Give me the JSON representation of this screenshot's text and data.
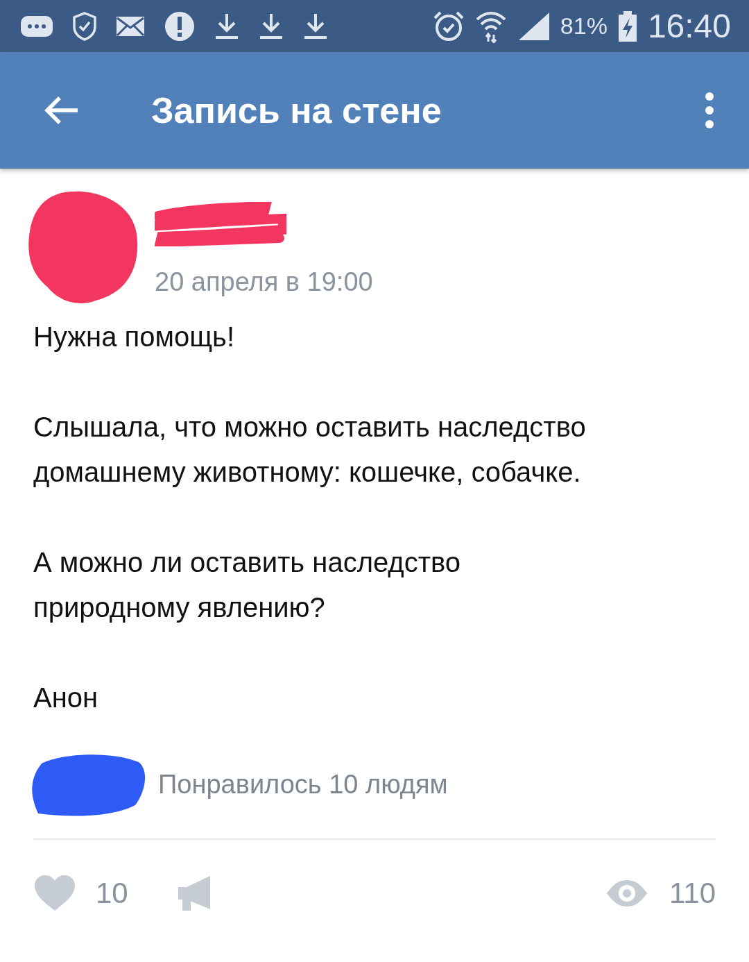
{
  "status_bar": {
    "battery": "81%",
    "time": "16:40"
  },
  "app_bar": {
    "title": "Запись на стене"
  },
  "post": {
    "date": "20 апреля в 19:00",
    "paragraphs": [
      "Нужна помощь!",
      "Слышала, что можно оставить наследство домашнему животному: кошечке, собачке.",
      "А можно ли оставить наследство природному явлению?",
      "Анон"
    ],
    "likes_summary": "Понравилось 10 людям",
    "like_count": "10",
    "view_count": "110"
  }
}
